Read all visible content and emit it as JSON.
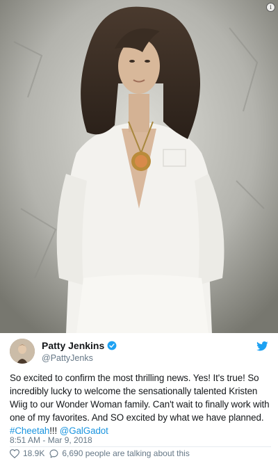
{
  "photo": {
    "alt_icon": "info-icon",
    "info_glyph": "i"
  },
  "author": {
    "name": "Patty Jenkins",
    "handle": "@PattyJenks",
    "verified": true
  },
  "tweet": {
    "text_before": "So excited to confirm the most thrilling news. Yes! It's true! So incredibly lucky to welcome the sensationally talented Kristen Wiig to our Wonder Woman family. Can't wait to finally work with one of my favorites. And SO excited by what we have planned.",
    "hashtag": "#Cheetah",
    "after_hashtag": "!!! ",
    "mention": "@GalGadot",
    "timestamp": "8:51 AM - Mar 9, 2018"
  },
  "footer": {
    "likes": "18.9K",
    "talking": "6,690 people are talking about this"
  },
  "colors": {
    "link": "#1b95e0",
    "meta": "#657786",
    "verified": "#1da1f2"
  }
}
